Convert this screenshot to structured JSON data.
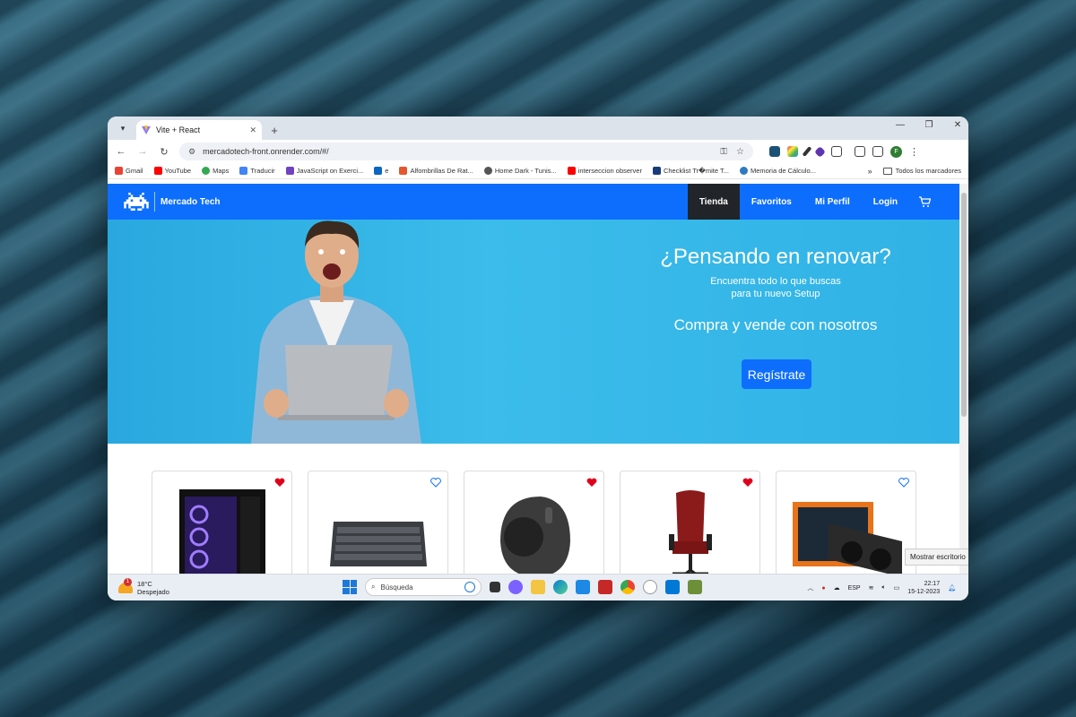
{
  "browser": {
    "tab_title": "Vite + React",
    "url": "mercadotech-front.onrender.com/#/",
    "bookmarks": [
      {
        "label": "Gmail",
        "color": "#ea4335"
      },
      {
        "label": "YouTube",
        "color": "#ff0000"
      },
      {
        "label": "Maps",
        "color": "#34a853"
      },
      {
        "label": "Traducir",
        "color": "#4285f4"
      },
      {
        "label": "JavaScript on Exerci...",
        "color": "#6f42c1"
      },
      {
        "label": "e",
        "color": "#0a66c2"
      },
      {
        "label": "Alfombrillas De Rat...",
        "color": "#e4572e"
      },
      {
        "label": "Home Dark - Tunis...",
        "color": "#555555"
      },
      {
        "label": "interseccion observer",
        "color": "#ff0000"
      },
      {
        "label": "Checklist Tr�mite T...",
        "color": "#1a3b7a"
      },
      {
        "label": "Memoria de Cálculo...",
        "color": "#2f7bbf"
      }
    ],
    "all_bookmarks": "Todos los marcadores",
    "more": "»"
  },
  "site": {
    "brand": "Mercado Tech",
    "nav": {
      "tienda": "Tienda",
      "favoritos": "Favoritos",
      "perfil": "Mi Perfil",
      "login": "Login"
    },
    "hero": {
      "title": "¿Pensando en renovar?",
      "subtitle_line1": "Encuentra todo lo que buscas",
      "subtitle_line2": "para tu nuevo Setup",
      "cta": "Compra y vende con nosotros",
      "button": "Regístrate"
    },
    "products": [
      {
        "name": "pc-case",
        "favorite": true
      },
      {
        "name": "keyboard",
        "favorite": false
      },
      {
        "name": "trackball-mouse",
        "favorite": true
      },
      {
        "name": "gaming-chair",
        "favorite": true
      },
      {
        "name": "graphics-card",
        "favorite": false
      }
    ],
    "colors": {
      "primary": "#0d6efd",
      "heart": "#e0001b",
      "nav_active": "#212529"
    }
  },
  "taskbar": {
    "temperature": "18°C",
    "weather": "Despejado",
    "weather_badge": "1",
    "search_placeholder": "Búsqueda",
    "language": "ESP",
    "time": "22:17",
    "date": "15-12-2023",
    "tooltip": "Mostrar escritorio"
  }
}
